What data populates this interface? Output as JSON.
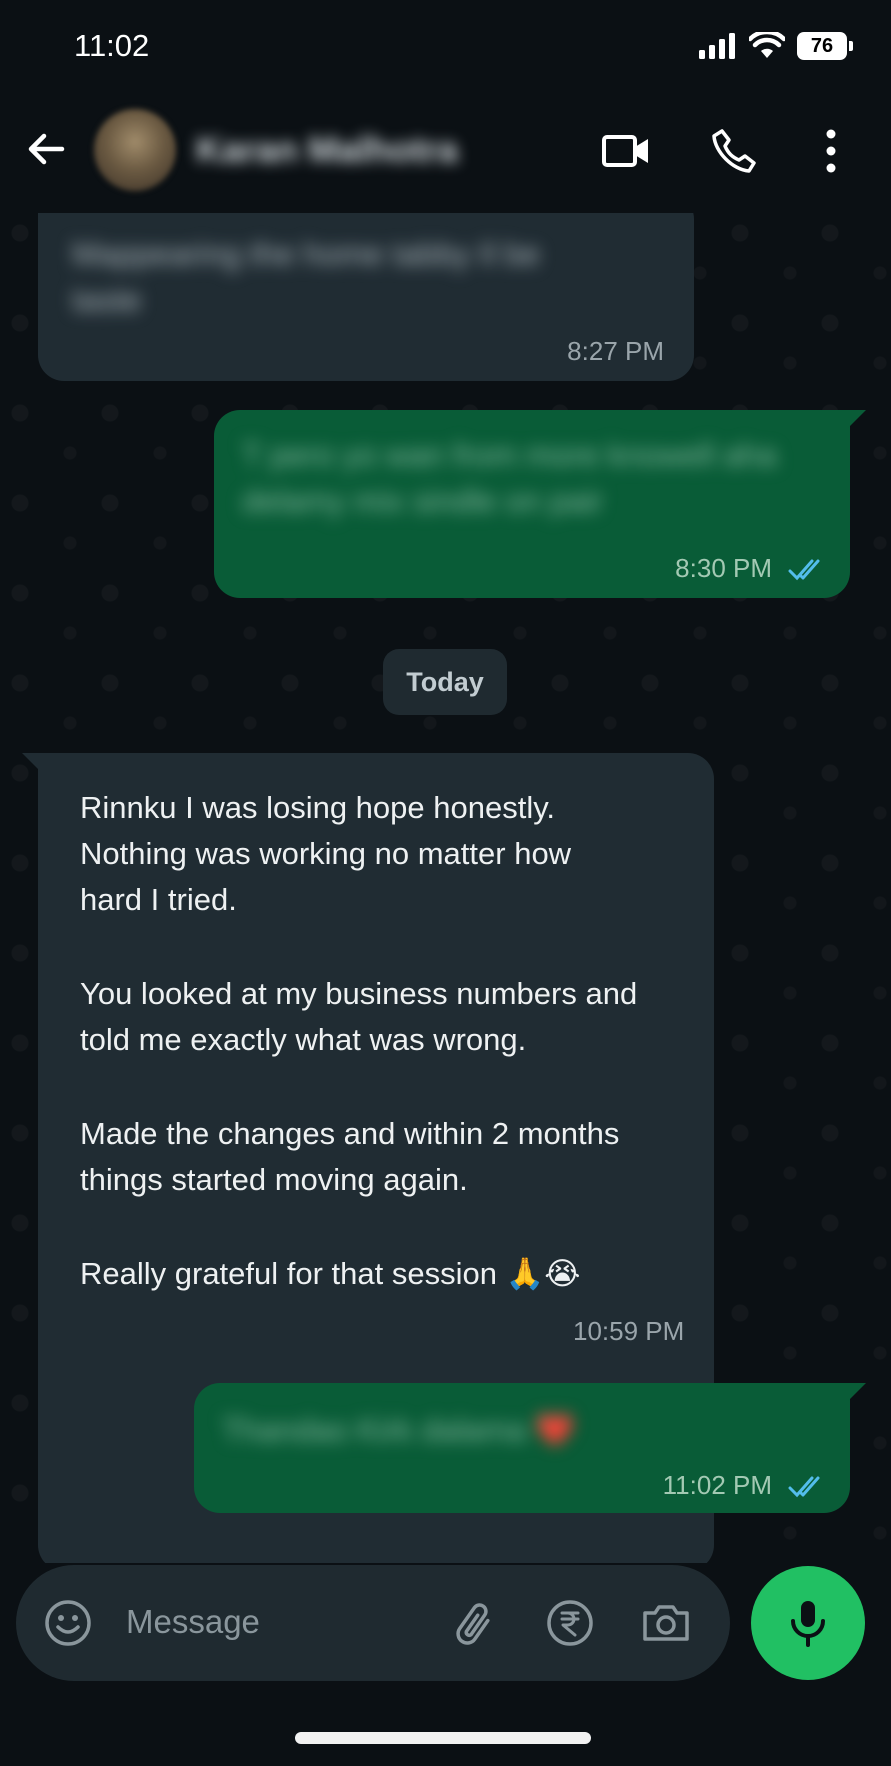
{
  "status_bar": {
    "time": "11:02",
    "battery": "76"
  },
  "header": {
    "contact_name": "Karan Malhotra"
  },
  "messages": [
    {
      "direction": "in",
      "text": "Mappearing the home tabby Il be taste",
      "time": "8:27 PM"
    },
    {
      "direction": "out",
      "text": "T pero yo wan from more knowell aha delamy mix sindle on pair",
      "time": "8:30 PM"
    },
    {
      "direction": "date",
      "text": "Today"
    },
    {
      "direction": "in",
      "paragraphs": [
        "Rinnku I was losing hope honestly. Nothing was working no matter how hard I tried.",
        "You looked at my business numbers and told me exactly what was wrong.",
        "Made the changes and within 2 months things started moving again.",
        "Really grateful for that session 🙏😭"
      ],
      "time": "10:59 PM"
    },
    {
      "direction": "out",
      "text": "Thandao Kirk dalama ❤️",
      "time": "11:02 PM"
    }
  ],
  "composer": {
    "placeholder": "Message"
  },
  "colors": {
    "accent": "#21c063",
    "outgoing": "#095c37",
    "incoming": "#202c33",
    "read_ticks": "#53bdeb"
  }
}
